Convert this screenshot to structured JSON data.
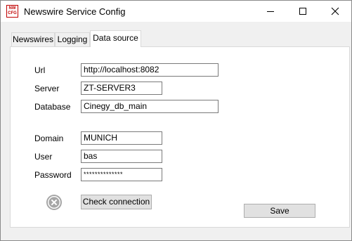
{
  "window": {
    "title": "Newswire Service Config",
    "app_icon_text": [
      "NW",
      "CFG"
    ],
    "app_icon_color": "#c00000",
    "controls": [
      "minimize-icon",
      "maximize-icon",
      "close-icon"
    ]
  },
  "tabs": [
    {
      "label": "Newswires",
      "selected": false
    },
    {
      "label": "Logging",
      "selected": false
    },
    {
      "label": "Data source",
      "selected": true
    }
  ],
  "form": {
    "url": {
      "label": "Url",
      "value": "http://localhost:8082"
    },
    "server": {
      "label": "Server",
      "value": "ZT-SERVER3"
    },
    "database": {
      "label": "Database",
      "value": "Cinegy_db_main"
    },
    "domain": {
      "label": "Domain",
      "value": "MUNICH"
    },
    "user": {
      "label": "User",
      "value": "bas"
    },
    "password": {
      "label": "Password",
      "value": "**************"
    }
  },
  "connection_status": {
    "icon": "x-circle-icon",
    "color": "#a6a6a6"
  },
  "buttons": {
    "check_connection": "Check connection",
    "save": "Save"
  }
}
